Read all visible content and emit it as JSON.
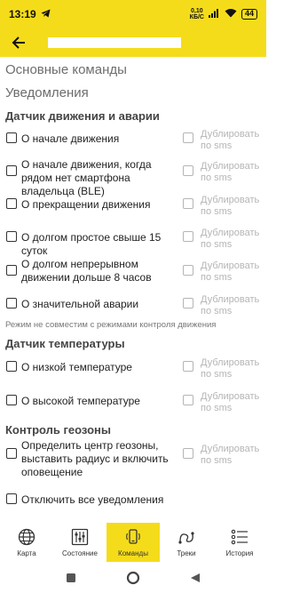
{
  "status_bar": {
    "time": "13:19",
    "net_speed_value": "0,10",
    "net_speed_unit": "КБ/С",
    "battery": "44",
    "icons": [
      "telegram-icon",
      "wifi-icon",
      "signal-icon",
      "battery-icon"
    ]
  },
  "app_bar": {
    "back_icon": "arrow-left-icon"
  },
  "main": {
    "links": [
      "Основные команды",
      "Уведомления"
    ],
    "sections": [
      {
        "title": "Датчик движения и аварии",
        "rows": [
          {
            "label": "О начале движения",
            "sms": "Дублировать по sms"
          },
          {
            "label": "О начале движения, когда рядом нет смартфона владельца (BLE)",
            "sms": "Дублировать по sms"
          },
          {
            "label": "О прекращении движения",
            "sms": "Дублировать по sms"
          },
          {
            "label": "О долгом простое свыше 15 суток",
            "sms": "Дублировать по sms"
          },
          {
            "label": "О долгом непрерывном движении дольше 8 часов",
            "sms": "Дублировать по sms"
          },
          {
            "label": "О значительной аварии",
            "sms": "Дублировать по sms"
          }
        ],
        "note": "Режим не совместим с режимами контроля движения"
      },
      {
        "title": "Датчик температуры",
        "rows": [
          {
            "label": "О низкой температуре",
            "sms": "Дублировать по sms"
          },
          {
            "label": "О высокой температуре",
            "sms": "Дублировать по sms"
          }
        ]
      },
      {
        "title": "Контроль геозоны",
        "rows": [
          {
            "label": "Определить центр геозоны, выставить радиус и включить оповещение",
            "sms": "Дублировать по sms"
          }
        ]
      }
    ],
    "disable_all": "Отключить все уведомления"
  },
  "bottom_nav": {
    "items": [
      {
        "label": "Карта",
        "icon": "globe-icon"
      },
      {
        "label": "Состояние",
        "icon": "sliders-icon"
      },
      {
        "label": "Команды",
        "icon": "phone-signal-icon",
        "active": true
      },
      {
        "label": "Треки",
        "icon": "route-icon"
      },
      {
        "label": "История",
        "icon": "list-icon"
      }
    ]
  },
  "colors": {
    "accent": "#f5dc1a",
    "disabled": "#b5b5b5",
    "section_title": "#444444"
  }
}
